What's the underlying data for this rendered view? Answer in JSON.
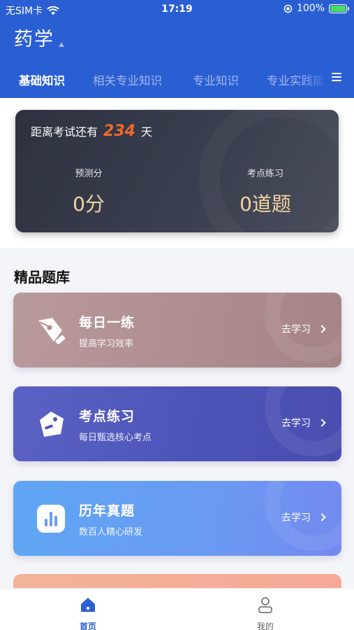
{
  "status_bar": {
    "carrier": "无SIM卡",
    "time": "17:19",
    "battery": "100%"
  },
  "app": {
    "title": "药学"
  },
  "tabs": [
    {
      "label": "基础知识",
      "active": true
    },
    {
      "label": "相关专业知识",
      "active": false
    },
    {
      "label": "专业知识",
      "active": false
    },
    {
      "label": "专业实践能",
      "active": false
    }
  ],
  "exam_card": {
    "countdown_prefix": "距离考试还有",
    "countdown_days": "234",
    "countdown_suffix": "天",
    "predicted_label": "预测分",
    "predicted_value": "0分",
    "practice_label": "考点练习",
    "practice_value": "0道题"
  },
  "section": {
    "title": "精品题库"
  },
  "question_banks": [
    {
      "title": "每日一练",
      "subtitle": "提高学习效率",
      "action": "去学习",
      "icon": "pen-nib-icon"
    },
    {
      "title": "考点练习",
      "subtitle": "每日甄选核心考点",
      "action": "去学习",
      "icon": "tag-icon"
    },
    {
      "title": "历年真题",
      "subtitle": "数百人精心研发",
      "action": "去学习",
      "icon": "bar-chart-icon"
    }
  ],
  "bottom_nav": [
    {
      "label": "首页",
      "icon": "home-icon",
      "active": true
    },
    {
      "label": "我的",
      "icon": "user-icon",
      "active": false
    }
  ],
  "colors": {
    "brand": "#2a5fd3",
    "countdown_accent": "#f06a2a",
    "stat_value": "#f1d3a0"
  }
}
